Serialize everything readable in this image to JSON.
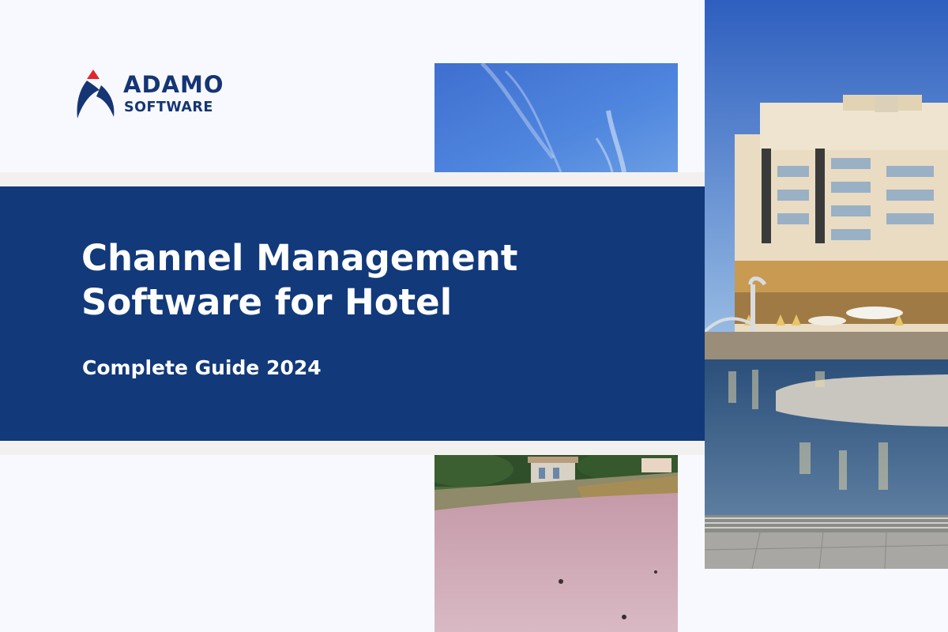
{
  "brand": {
    "name_line1": "ADAMO",
    "name_line2": "SOFTWARE",
    "logo_icon": "adamo-swoosh-logo-icon",
    "colors": {
      "navy": "#153574",
      "accent_red": "#e2262b",
      "band": "#12397a"
    }
  },
  "hero": {
    "title_line1": "Channel Management",
    "title_line2": "Software for Hotel",
    "subtitle": "Complete Guide 2024"
  },
  "images": {
    "sky": "blue-sky-photo",
    "beach": "pink-sand-beach-photo",
    "hotel": "hotel-pool-photo"
  }
}
